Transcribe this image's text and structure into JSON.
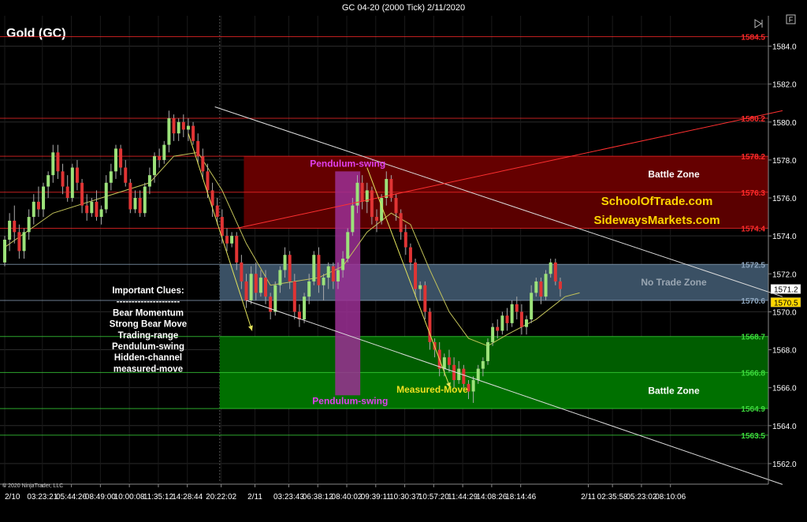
{
  "window": {
    "title": "GC 04-20 (2000 Tick)  2/11/2020",
    "copyright": "© 2020 NinjaTrader, LLC",
    "f_button": "F"
  },
  "chart_data": {
    "type": "candlestick",
    "instrument_label": "Gold (GC)",
    "ylim": [
      1561.0,
      1585.6
    ],
    "y_ticks": [
      1562.0,
      1564.0,
      1566.0,
      1568.0,
      1570.0,
      1572.0,
      1574.0,
      1576.0,
      1578.0,
      1580.0,
      1582.0,
      1584.0
    ],
    "y_tick_labels": [
      "1562.0",
      "1564.0",
      "1566.0",
      "1568.0",
      "1570.0",
      "1572.0",
      "1574.0",
      "1576.0",
      "1578.0",
      "1580.0",
      "1582.0",
      "1584.0"
    ],
    "x_axis_labels": [
      "2/10",
      "03:23:21",
      "05:44:26",
      "08:49:00",
      "10:00:08",
      "11:35:12",
      "14:28:44",
      "20:22:02",
      "2/11",
      "03:23:43",
      "06:38:12",
      "08:40:02",
      "09:39:11",
      "10:30:37",
      "10:57:20",
      "11:44:29",
      "14:08:26",
      "18:14:46",
      "2/11",
      "02:35:58",
      "05:23:02",
      "08:10:06"
    ],
    "x_tick_bars": [
      0,
      7.8,
      13.8,
      19.8,
      25.8,
      31.8,
      37.8,
      44.8,
      51.8,
      58.8,
      64.8,
      70.8,
      76.8,
      82.8,
      88.8,
      94.8,
      100.8,
      106.8,
      120.8,
      125.8,
      131.8,
      137.8
    ],
    "session_break_bar": 44.5,
    "candles": [
      [
        1572.6,
        1574.0,
        1572.4,
        1573.8
      ],
      [
        1573.8,
        1575.2,
        1573.2,
        1574.8
      ],
      [
        1574.8,
        1575.6,
        1573.6,
        1574.2
      ],
      [
        1574.2,
        1574.6,
        1572.8,
        1573.2
      ],
      [
        1573.2,
        1574.4,
        1572.8,
        1574.2
      ],
      [
        1574.2,
        1575.4,
        1573.8,
        1575.0
      ],
      [
        1575.0,
        1576.2,
        1574.6,
        1575.8
      ],
      [
        1575.8,
        1576.6,
        1575.0,
        1575.4
      ],
      [
        1575.4,
        1576.8,
        1575.0,
        1576.6
      ],
      [
        1576.6,
        1577.4,
        1576.0,
        1577.2
      ],
      [
        1577.2,
        1578.8,
        1576.8,
        1578.4
      ],
      [
        1578.4,
        1578.8,
        1577.0,
        1577.4
      ],
      [
        1577.4,
        1577.8,
        1576.2,
        1576.6
      ],
      [
        1576.6,
        1577.2,
        1575.8,
        1576.0
      ],
      [
        1576.0,
        1577.8,
        1575.8,
        1577.6
      ],
      [
        1577.6,
        1578.0,
        1576.4,
        1576.8
      ],
      [
        1576.8,
        1577.0,
        1575.2,
        1575.6
      ],
      [
        1575.6,
        1576.2,
        1574.8,
        1575.2
      ],
      [
        1575.2,
        1576.0,
        1575.0,
        1575.8
      ],
      [
        1575.8,
        1576.4,
        1574.8,
        1575.0
      ],
      [
        1575.0,
        1575.6,
        1574.6,
        1575.4
      ],
      [
        1575.4,
        1577.2,
        1575.2,
        1576.8
      ],
      [
        1576.8,
        1577.8,
        1576.4,
        1577.4
      ],
      [
        1577.4,
        1578.8,
        1577.0,
        1578.6
      ],
      [
        1578.6,
        1578.8,
        1577.2,
        1577.6
      ],
      [
        1577.6,
        1578.0,
        1576.6,
        1576.8
      ],
      [
        1576.8,
        1577.0,
        1575.2,
        1575.4
      ],
      [
        1575.4,
        1576.4,
        1575.2,
        1576.0
      ],
      [
        1576.0,
        1576.4,
        1575.0,
        1575.2
      ],
      [
        1575.2,
        1576.8,
        1575.0,
        1576.6
      ],
      [
        1576.6,
        1577.6,
        1576.2,
        1577.2
      ],
      [
        1577.2,
        1578.4,
        1576.8,
        1578.2
      ],
      [
        1578.2,
        1578.6,
        1577.6,
        1578.0
      ],
      [
        1578.0,
        1579.0,
        1577.8,
        1578.8
      ],
      [
        1578.8,
        1580.6,
        1578.4,
        1580.2
      ],
      [
        1580.2,
        1580.4,
        1579.0,
        1579.4
      ],
      [
        1579.4,
        1580.2,
        1579.0,
        1580.0
      ],
      [
        1580.0,
        1580.4,
        1579.2,
        1579.6
      ],
      [
        1579.6,
        1580.2,
        1579.0,
        1579.8
      ],
      [
        1579.8,
        1580.0,
        1578.8,
        1579.0
      ],
      [
        1579.0,
        1579.4,
        1577.8,
        1578.2
      ],
      [
        1578.2,
        1578.6,
        1577.0,
        1577.4
      ],
      [
        1577.4,
        1577.8,
        1576.0,
        1576.4
      ],
      [
        1576.4,
        1576.8,
        1575.0,
        1575.6
      ],
      [
        1575.6,
        1576.0,
        1574.6,
        1575.0
      ],
      [
        1575.0,
        1575.4,
        1573.6,
        1574.0
      ],
      [
        1574.0,
        1574.4,
        1573.2,
        1573.6
      ],
      [
        1573.6,
        1574.2,
        1573.4,
        1574.0
      ],
      [
        1574.0,
        1574.2,
        1572.2,
        1572.6
      ],
      [
        1572.6,
        1573.0,
        1571.2,
        1571.6
      ],
      [
        1571.6,
        1572.0,
        1570.2,
        1570.6
      ],
      [
        1570.6,
        1572.4,
        1570.4,
        1572.0
      ],
      [
        1572.0,
        1572.6,
        1570.6,
        1571.0
      ],
      [
        1571.0,
        1572.2,
        1570.8,
        1571.8
      ],
      [
        1571.8,
        1572.2,
        1570.4,
        1570.8
      ],
      [
        1570.8,
        1571.0,
        1569.6,
        1570.0
      ],
      [
        1570.0,
        1571.6,
        1569.8,
        1571.4
      ],
      [
        1571.4,
        1572.4,
        1571.0,
        1572.2
      ],
      [
        1572.2,
        1573.4,
        1571.8,
        1573.0
      ],
      [
        1573.0,
        1573.2,
        1571.2,
        1571.6
      ],
      [
        1571.6,
        1572.0,
        1569.6,
        1570.0
      ],
      [
        1570.0,
        1570.4,
        1569.2,
        1569.6
      ],
      [
        1569.6,
        1571.0,
        1569.4,
        1570.8
      ],
      [
        1570.8,
        1572.0,
        1570.4,
        1571.6
      ],
      [
        1571.6,
        1573.2,
        1571.4,
        1573.0
      ],
      [
        1573.0,
        1573.4,
        1571.0,
        1571.4
      ],
      [
        1571.4,
        1572.0,
        1570.6,
        1571.8
      ],
      [
        1571.8,
        1572.6,
        1571.2,
        1572.4
      ],
      [
        1572.4,
        1572.6,
        1571.2,
        1571.6
      ],
      [
        1571.6,
        1572.6,
        1571.2,
        1572.2
      ],
      [
        1572.2,
        1573.2,
        1571.8,
        1572.8
      ],
      [
        1572.8,
        1574.4,
        1572.6,
        1574.2
      ],
      [
        1574.2,
        1576.0,
        1574.0,
        1575.6
      ],
      [
        1575.6,
        1577.2,
        1575.2,
        1576.8
      ],
      [
        1576.8,
        1577.2,
        1575.4,
        1575.8
      ],
      [
        1575.8,
        1576.8,
        1575.2,
        1576.4
      ],
      [
        1576.4,
        1576.6,
        1574.6,
        1575.0
      ],
      [
        1575.0,
        1575.4,
        1574.2,
        1574.8
      ],
      [
        1574.8,
        1576.2,
        1574.6,
        1576.0
      ],
      [
        1576.0,
        1577.4,
        1575.6,
        1577.0
      ],
      [
        1577.0,
        1577.2,
        1575.8,
        1576.0
      ],
      [
        1576.0,
        1576.2,
        1574.8,
        1575.2
      ],
      [
        1575.2,
        1575.4,
        1573.8,
        1574.2
      ],
      [
        1574.2,
        1574.6,
        1573.0,
        1573.4
      ],
      [
        1573.4,
        1573.6,
        1572.2,
        1572.6
      ],
      [
        1572.6,
        1572.8,
        1570.8,
        1571.2
      ],
      [
        1571.2,
        1571.6,
        1570.6,
        1571.4
      ],
      [
        1571.4,
        1571.6,
        1569.6,
        1570.0
      ],
      [
        1570.0,
        1570.2,
        1568.0,
        1568.4
      ],
      [
        1568.4,
        1568.6,
        1567.6,
        1568.0
      ],
      [
        1568.0,
        1568.4,
        1566.6,
        1567.0
      ],
      [
        1567.0,
        1567.8,
        1566.6,
        1567.6
      ],
      [
        1567.6,
        1568.0,
        1566.8,
        1567.2
      ],
      [
        1567.2,
        1567.6,
        1566.0,
        1566.4
      ],
      [
        1566.4,
        1567.4,
        1566.2,
        1567.0
      ],
      [
        1567.0,
        1567.2,
        1565.8,
        1566.2
      ],
      [
        1566.2,
        1566.4,
        1565.4,
        1565.8
      ],
      [
        1565.8,
        1566.6,
        1565.2,
        1566.4
      ],
      [
        1566.4,
        1567.2,
        1566.2,
        1567.0
      ],
      [
        1567.0,
        1567.6,
        1566.6,
        1567.4
      ],
      [
        1567.4,
        1568.6,
        1567.2,
        1568.4
      ],
      [
        1568.4,
        1569.4,
        1568.2,
        1569.2
      ],
      [
        1569.2,
        1569.6,
        1568.6,
        1569.0
      ],
      [
        1569.0,
        1570.0,
        1568.8,
        1569.8
      ],
      [
        1569.8,
        1570.2,
        1569.0,
        1569.4
      ],
      [
        1569.4,
        1570.6,
        1569.2,
        1570.4
      ],
      [
        1570.4,
        1570.8,
        1569.6,
        1570.0
      ],
      [
        1570.0,
        1570.4,
        1568.8,
        1569.2
      ],
      [
        1569.2,
        1569.8,
        1568.8,
        1569.6
      ],
      [
        1569.6,
        1571.4,
        1569.4,
        1571.0
      ],
      [
        1571.0,
        1571.8,
        1570.8,
        1571.6
      ],
      [
        1571.6,
        1571.8,
        1570.4,
        1570.8
      ],
      [
        1570.8,
        1572.2,
        1570.6,
        1572.0
      ],
      [
        1572.0,
        1572.8,
        1571.8,
        1572.6
      ],
      [
        1572.6,
        1572.8,
        1571.4,
        1571.6
      ],
      [
        1571.6,
        1571.8,
        1570.8,
        1571.2
      ]
    ],
    "moving_average": [
      [
        0,
        1573.4
      ],
      [
        10,
        1575.2
      ],
      [
        20,
        1576.0
      ],
      [
        30,
        1576.8
      ],
      [
        35,
        1578.2
      ],
      [
        40,
        1578.4
      ],
      [
        45,
        1576.4
      ],
      [
        50,
        1573.6
      ],
      [
        55,
        1571.4
      ],
      [
        60,
        1571.6
      ],
      [
        65,
        1571.8
      ],
      [
        70,
        1572.4
      ],
      [
        75,
        1574.2
      ],
      [
        80,
        1575.2
      ],
      [
        84,
        1574.6
      ],
      [
        88,
        1572.2
      ],
      [
        92,
        1570.0
      ],
      [
        96,
        1568.6
      ],
      [
        100,
        1568.2
      ],
      [
        104,
        1568.8
      ],
      [
        110,
        1569.6
      ],
      [
        116,
        1570.8
      ],
      [
        119,
        1571.0
      ]
    ],
    "horizontal_lines": [
      {
        "price": 1584.5,
        "label": "1584.5",
        "color": "#ff2a2a"
      },
      {
        "price": 1580.2,
        "label": "1580.2",
        "color": "#ff2a2a"
      },
      {
        "price": 1578.2,
        "label": "1578.2",
        "color": "#ff2a2a"
      },
      {
        "price": 1576.3,
        "label": "1576.3",
        "color": "#ff2a2a"
      },
      {
        "price": 1574.4,
        "label": "1574.4",
        "color": "#ff2a2a"
      },
      {
        "price": 1572.5,
        "label": "1572.5",
        "color": "#8fa7bf"
      },
      {
        "price": 1570.6,
        "label": "1570.6",
        "color": "#8fa7bf"
      },
      {
        "price": 1568.7,
        "label": "1568.7",
        "color": "#3ddc3d"
      },
      {
        "price": 1566.8,
        "label": "1566.8",
        "color": "#3ddc3d"
      },
      {
        "price": 1564.9,
        "label": "1564.9",
        "color": "#3ddc3d"
      },
      {
        "price": 1563.5,
        "label": "1563.5",
        "color": "#3ddc3d"
      }
    ],
    "zones": [
      {
        "from_bar": 49.5,
        "to_bar": 161,
        "low": 1576.3,
        "high": 1578.2,
        "color": "#650000",
        "label": "Battle Zone",
        "label_color": "#ffffff"
      },
      {
        "from_bar": 49.5,
        "to_bar": 161,
        "low": 1574.4,
        "high": 1576.3,
        "color": "#5a0000",
        "label": "",
        "label_color": "#ffffff"
      },
      {
        "from_bar": 44.5,
        "to_bar": 161,
        "low": 1570.6,
        "high": 1572.5,
        "color": "#3a5064",
        "label": "No Trade Zone",
        "label_color": "#9aa6b2"
      },
      {
        "from_bar": 44.5,
        "to_bar": 161,
        "low": 1566.8,
        "high": 1568.7,
        "color": "#005d00",
        "label": "",
        "label_color": "#ffffff"
      },
      {
        "from_bar": 44.5,
        "to_bar": 161,
        "low": 1564.9,
        "high": 1566.8,
        "color": "#007000",
        "label": "Battle Zone",
        "label_color": "#ffffff"
      }
    ],
    "pendulum_box": {
      "from_bar": 68.4,
      "to_bar": 73.6,
      "low": 1565.6,
      "high": 1577.4,
      "color": "#9b2f94"
    },
    "trend_lines": [
      {
        "x1": 43.5,
        "y1": 1580.8,
        "x2": 161,
        "y2": 1570.8,
        "color": "#dddddd"
      },
      {
        "x1": 50,
        "y1": 1570.6,
        "x2": 161,
        "y2": 1560.9,
        "color": "#dddddd"
      },
      {
        "x1": 48,
        "y1": 1574.4,
        "x2": 161,
        "y2": 1580.6,
        "color": "#ff3030"
      }
    ],
    "arrows": [
      {
        "x1": 38,
        "y1": 1579.4,
        "x2": 51.2,
        "y2": 1569.0,
        "color": "#e3e35a"
      },
      {
        "x1": 75,
        "y1": 1577.6,
        "x2": 92.2,
        "y2": 1566.0,
        "color": "#e3e35a"
      }
    ],
    "annotations": [
      {
        "text": "Pendulum-swing",
        "bar": 71,
        "price": 1577.8,
        "color": "#e040ee",
        "size": 12
      },
      {
        "text": "Pendulum-swing",
        "bar": 71.5,
        "price": 1565.3,
        "color": "#e040ee",
        "size": 12
      },
      {
        "text": "Measured-Move",
        "bar": 88.5,
        "price": 1565.9,
        "color": "#f0e020",
        "size": 12
      },
      {
        "text": "SchoolOfTrade.com",
        "bar": 135,
        "price": 1575.8,
        "color": "#ffd700",
        "size": 15
      },
      {
        "text": "SidewaysMarkets.com",
        "bar": 135,
        "price": 1574.8,
        "color": "#ffd700",
        "size": 15
      }
    ],
    "clues_lines": [
      "Important Clues:",
      "---------------------",
      "Bear Momentum",
      "Strong Bear Move",
      "Trading-range",
      "Pendulum-swing",
      "Hidden-channel",
      "measured-move"
    ],
    "price_markers": [
      {
        "price": 1571.2,
        "label": "1571.2",
        "bg": "#ffffff",
        "fg": "#000000"
      },
      {
        "price": 1570.5,
        "label": "1570.5",
        "bg": "#ffd700",
        "fg": "#000000"
      }
    ],
    "colors": {
      "up": "#9ce27a",
      "down": "#e03434",
      "ma": "#c3c35a",
      "grid": "#2a2a2a",
      "axis_text": "#ffffff"
    }
  }
}
